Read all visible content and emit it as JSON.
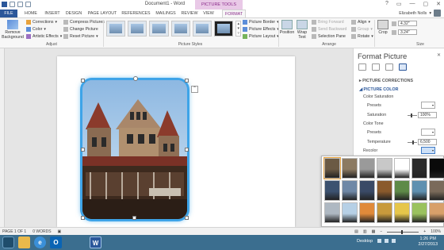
{
  "window": {
    "title": "Document1 - Word",
    "contextual_tab_group": "PICTURE TOOLS",
    "controls": [
      "?",
      "▭",
      "—",
      "▢",
      "✕"
    ]
  },
  "tabs": [
    {
      "label": "FILE"
    },
    {
      "label": "HOME"
    },
    {
      "label": "INSERT"
    },
    {
      "label": "DESIGN"
    },
    {
      "label": "PAGE LAYOUT"
    },
    {
      "label": "REFERENCES"
    },
    {
      "label": "MAILINGS"
    },
    {
      "label": "REVIEW"
    },
    {
      "label": "VIEW"
    },
    {
      "label": "FORMAT"
    }
  ],
  "user": {
    "name": "Elizabeth Nolls"
  },
  "ribbon": {
    "adjust": {
      "remove_background": "Remove Background",
      "corrections": "Corrections",
      "color": "Color",
      "artistic_effects": "Artistic Effects",
      "compress_pictures": "Compress Pictures",
      "change_picture": "Change Picture",
      "reset_picture": "Reset Picture",
      "group_label": "Adjust"
    },
    "picture_styles": {
      "picture_border": "Picture Border",
      "picture_effects": "Picture Effects",
      "picture_layout": "Picture Layout",
      "group_label": "Picture Styles"
    },
    "arrange": {
      "position": "Position",
      "wrap_text": "Wrap Text",
      "bring_forward": "Bring Forward",
      "send_backward": "Send Backward",
      "selection_pane": "Selection Pane",
      "align": "Align",
      "group": "Group",
      "rotate": "Rotate",
      "group_label": "Arrange"
    },
    "size": {
      "crop": "Crop",
      "height": "4.32\"",
      "width": "3.24\"",
      "group_label": "Size"
    }
  },
  "pane": {
    "title": "Format Picture",
    "close": "✕",
    "sections": {
      "picture_corrections": "PICTURE CORRECTIONS",
      "picture_color": "PICTURE COLOR"
    },
    "color_saturation": "Color Saturation",
    "presets": "Presets",
    "saturation_label": "Saturation",
    "saturation_value": "100%",
    "color_tone": "Color Tone",
    "presets_2": "Presets",
    "temperature_label": "Temperature",
    "temperature_value": "6,500",
    "recolor_label": "Recolor"
  },
  "recolor": {
    "swatches": [
      "#6b5a44",
      "#8c7a62",
      "#9a9a9a",
      "#c8c8c8",
      "#ffffff",
      "#2a2a2a",
      "#0a0a0a",
      "#3c5270",
      "#6f88a6",
      "#3a4a66",
      "#8a5a2c",
      "#5e8a48",
      "#5f90b0",
      "#7a6a5a",
      "#aeb8c2",
      "#b6d0e6",
      "#e08a3a",
      "#c89a3c",
      "#e6c64a",
      "#9ac25e",
      "#d8a06a"
    ]
  },
  "status_bar": {
    "page": "PAGE 1 OF 1",
    "words": "0 WORDS",
    "zoom": "100%"
  },
  "taskbar": {
    "desktop_label": "Desktop",
    "time": "1:26 PM",
    "date": "2/27/2013"
  },
  "colors": {
    "word_blue": "#2b579a",
    "picture_tools": "#e9c9e7",
    "selection_glow": "#3ea4e8",
    "taskbar": "#3b6e8f"
  }
}
